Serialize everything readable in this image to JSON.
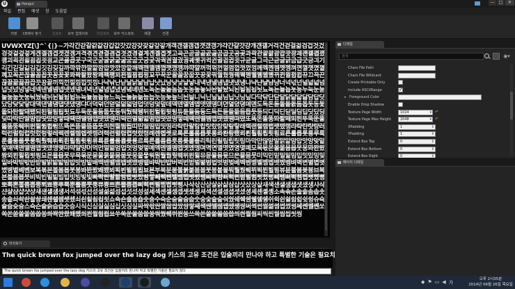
{
  "window": {
    "tab_title": "Hangul",
    "controls": [
      "—",
      "□",
      "✕"
    ]
  },
  "menu": {
    "items": [
      "파일",
      "편집",
      "애셋",
      "창",
      "도움말"
    ]
  },
  "toolbar": {
    "items": [
      {
        "label": "저장",
        "icon": "save-icon",
        "color": "#4f8fd6",
        "dim": false
      },
      {
        "label": "CB에서 찾기",
        "icon": "find-in-cb-icon",
        "color": "#8f8f8f",
        "dim": false
      },
      {
        "label": "임포트",
        "icon": "import-icon",
        "color": "#555555",
        "dim": true
      },
      {
        "label": "모두 업데이트",
        "icon": "update-all-icon",
        "color": "#6c6c6c",
        "dim": false
      },
      {
        "label": "리임포트",
        "icon": "reimport-icon",
        "color": "#555555",
        "dim": true
      },
      {
        "label": "모두 익스포트",
        "icon": "export-all-icon",
        "color": "#6c6c6c",
        "dim": false
      },
      {
        "label": "배경",
        "icon": "background-icon",
        "color": "#8a8aa8",
        "dim": false
      },
      {
        "label": "전경",
        "icon": "foreground-icon",
        "color": "#7a9ad0",
        "dim": false
      }
    ]
  },
  "viewport": {
    "glyphs": "UVWXYZ[\\]^`{|}~가각간갇갈갉갊감갑값갓갔강갖갗같갚갛개객갠갤갬갭갯갰갱갸갹갼걀걋걍걔걘걜거걱건걷걸걺검겁것겄겅겆겉겊겋게겐겔겜겝겟겠겡겨격겪견겯결겸겹겻겼경곁계곈곌곕곗고곡곤곧골곪곬곯곰곱곳공곶과곽관괄괆괌괍괏광괘괜괠괩괬괭괴괵괸괼굄굅굇굉교굔굘굡굣구국군굳굴굵굶굻굼굽굿궁궂궈궉권궐궜궝궤궷귀귁귄귈귐귑귓규균귤그극근귿글긁금급긋긍긔기긱긴긷길긺김깁깃깅깆깊까깍깎깐깔깖깜깝깟깠깡깥깨깩깬깰깸깹깻깼깽꺄꺅꺌꺼꺽꺾껀껄껌껍껏껐껑께껙껜껨껫껭껴껸껼꼇꼈꼍꼐꼬꼭꼰꼲꼴꼼꼽꼿꽁꽂꽃꽈꽉꽐꽜꽝꽤꽥꽹꾀꾄꾈꾐꾑꾕꾜꾸꾹꾼꿀꿇꿈꿉꿋꿍꿎꿔꿜꿨꿩꿰꿱꿴꿸뀀뀁뀄뀌뀐뀔뀜뀝뀨끄끅끈끊끌끎끓끔끕끗끙끝끼끽낀낄낌낍낏낑나낙낚난낟날낡낢남납낫났낭낮낯낱낳내낵낸낼냄냅냇냈냉냐냑냔냘냠냥너넉넋넌널넒넓넘넙넛넜넝넣네넥넨넬넴넵넷넸넹녀녁년녈념녑녔녕녘녜녠노녹논놀놂놈놉놋농높놓놔놘놜놨뇌뇐뇔뇜뇝뇟뇨뇩뇬뇰뇹뇻뇽누눅눈눋눌눔눕눗눙눠눴눼뉘뉜뉠뉨뉩뉴뉵뉼늄늅늉느늑는늘늙늚늠늡늣능늦늪늬늰늴니닉닌닐닒님닙닛닝닢다닥닦단닫달닭닮닯닳담답닷닸당닺닻닿대댁댄댈댐댑댓댔댕댜더덕덖던덛덜덞덟덤덥덧덩덫덮데덱덴델뎀뎁뎃뎄뎅뎌뎐뎔뎠뎡뎨뎬도독돈돋돌돎돐돔돕돗동돛돝돠돤돨돼됐되된될됨됩됫됴두둑둔둘둠둡둣둥둬뒀뒈뒝뒤뒨뒬뒵뒷뒹듀듄듈듐듕드득든듣들듦듬듭듯등듸디딕딘딛딜딤딥딧딨딩딪따딱딴딸땀땁땃땄땅땋때땍땐땔땜땝땟땠땡떠떡떤떨떪떫떰떱떳떴떵떻떼떽뗀뗄뗌뗍뗏뗐뗑뗘뗬또똑똔똘똥똬똴뙈뙤뙨뚜뚝뚠뚤뚫뚬뚱뛔뛰뛴뛸뜀뜁뜅뜨뜩뜬뜯뜰뜸뜹뜻띄띈띌띔띕띠띤띨띰띱띳띵라락란랄람랍랏랐랑랒랖랗래랙랜랠램랩랫랬랭랴략랸럇량러럭런럴럼럽럿렀렁렇레렉렌렐렘렙렛렝려력련렬렴렵렷렸령례롄롑롓로록론롤롬롭롯롱롸롼뢍뢨뢰뢴뢸룀룁룃룅료룐룔룝룟룡루룩룬룰룸룹룻룽뤄뤘뤠뤼뤽륀륄륌륏륑류륙륜률륨륩륫륭르륵른를름릅릇릉릊릍릎리릭린릴림립릿링마막만많맏말맑맒맘맙맛망맞맡맣매맥맨맬맴맵맷맸맹맺먀먁먈먕머먹먼멀멂멈멉멋멍멎멓메멕멘멜멤멥멧멨멩며멱면멸몃몄명몇몌모목몫몬몰몲몸몹못몽뫄뫈뫘뫙뫼묀묄묍묏묑묘묜묠묩묫무묵묶문묻물묽묾뭄뭅뭇뭉뭍뭏뭐뭔뭘뭡뭣뭬뮈뮌뮐뮤뮨뮬뮴뮷므믄믈믐믓미믹민믿밀밂밈밉밋밌밍및밑바박밖밗반받발밝밞밟밤밥밧방밭배백밴밸뱀뱁뱃뱄뱅뱉뱌뱍뱐뱝버벅번벋벌벎범법벗벙벚베벡벤벧벨벰벱벳벴벵벼벽변별볍볏볐병볕볘볜보복볶본볼봄봅봇봉봐봔봤봬뵀뵈뵉뵌뵐뵘뵙뵤뵨부북분붇불붉붊붐붑붓붕붙붚붜붤붰붸뷔뷕뷘뷜뷩뷰뷴뷸븀븃븅브븍븐블븜븝븟비빅빈빌빎빔빕빗빙빚빛빠빡빤빨빪빰빱빳빴빵빻빼빽뺀뺄뺌뺍뺏뺐뺑뺘뺙뺨뻐뻑뻔뻗뻘뻠뻣뻤뻥뻬뼁뼈뼉뼘뼙뼛뼜뼝뽀뽁뽄뽈뽐뽑뽕뾔뾰뿅뿌뿍뿐뿔뿜뿟뿡쀼쁑쁘쁜쁠쁨쁩삐삑삔삘삠삡삣삥사삭삯산삳살삵삶삼삽삿샀상샅새색샌샐샘샙샛샜생샤샥샨샬샴샵샷샹섀섄섈섐섕서석섞섟선섣설섦섧섬섭섯섰성섶세섹센셀셈셉셋셌셍셔셕션셜셤셥셧셨셩셰셴셸솅소속솎손솔솖솜솝솟송솥솨솩솬솰솽쇄쇈쇌쇔쇗쇘쇠쇤쇨쇰쇱쇳쇼쇽숀숄숌숍숏숑수숙순숟술숨숩숫숭숯숱숲숴쉈쉐쉑쉔쉘쉠쉥쉬쉭쉰쉴쉼쉽쉿슁슈슉슐슘슛슝스슥슨슬슭슴습슷승시식신싣실싫심십싯싱싶싸싹싻싼쌀쌈쌉쌌쌍쌓쌔쌕쌘쌜쌤쌥쌨쌩썅써썩썬썰썲썸썹썼썽쎄쎈쎌쏀쏘쏙쏜쏟쏠쏢쏨쏩쏭쏴쏵쏸쐈쐐쐤쐬쐰쐴쐼쐽쑈쑤쑥쑨쑬쑴쑵쑹쒀쒔쒜쒸쒼쓩쓰쓱쓴쓸쓺쓿씀씁씌씐씔씜씨씩씬씰씸씹씻씽",
    "preview_sentence": "The quick brown fox jumped over the lazy dog 키스의 고유 조건은 입술끼리 만나야 하고 특별한 기술은 필요치"
  },
  "details": {
    "tab_label": "디테일",
    "search_placeholder": "검색",
    "properties": [
      {
        "label": "Chars File Path",
        "kind": "text",
        "value": ""
      },
      {
        "label": "Chars File Wildcard",
        "kind": "text",
        "value": ""
      },
      {
        "label": "Create Printable Only",
        "kind": "check",
        "checked": false
      },
      {
        "label": "Include ASCIIRange",
        "kind": "check",
        "checked": true
      },
      {
        "label": "Foreground Color",
        "kind": "color",
        "value": "",
        "section": true
      },
      {
        "label": "Enable Drop Shadow",
        "kind": "check",
        "checked": false
      },
      {
        "label": "Texture Page Width",
        "kind": "combo",
        "value": "1024"
      },
      {
        "label": "Texture Page Max Height",
        "kind": "combo",
        "value": "2048"
      },
      {
        "label": "XPadding",
        "kind": "spin",
        "value": "1"
      },
      {
        "label": "YPadding",
        "kind": "spin",
        "value": "1"
      },
      {
        "label": "Extend Box Top",
        "kind": "spin",
        "value": "0"
      },
      {
        "label": "Extend Box Bottom",
        "kind": "spin",
        "value": "0"
      },
      {
        "label": "Extend Box Right",
        "kind": "spin",
        "value": "0"
      }
    ]
  },
  "render_panel": {
    "tab_label": "페이지 디테일"
  },
  "preview": {
    "tab_label": "미리보기",
    "input_value": "The quick brown fox jumped over the lazy dog 키스의 고유 조건은 입술끼리 만나야 하고 특별한 기술은 필요치 않다"
  },
  "taskbar": {
    "apps": [
      {
        "icon": "windows-start-icon",
        "color": "#2d7be0"
      },
      {
        "icon": "chrome-icon",
        "color": "#d04a3a"
      },
      {
        "icon": "internet-explorer-icon",
        "color": "#2f8fde"
      },
      {
        "icon": "file-explorer-icon",
        "color": "#e1b54a"
      },
      {
        "icon": "media-player-icon",
        "color": "#4c4ca0"
      },
      {
        "icon": "app-icon-red",
        "color": "#222222"
      },
      {
        "icon": "unreal-engine-icon",
        "color": "#1c3e70"
      },
      {
        "icon": "unreal-editor-icon",
        "color": "#1a1a1a"
      },
      {
        "icon": "document-icon",
        "color": "#6aa8d0"
      }
    ],
    "clock_time": "오후 2시35분",
    "clock_date": "2014년 06월 26일 목요일"
  },
  "colors": {
    "background": "#1a1a1a",
    "panel": "#242424",
    "viewport": "#050505",
    "taskbar": "#1e2a3a"
  }
}
